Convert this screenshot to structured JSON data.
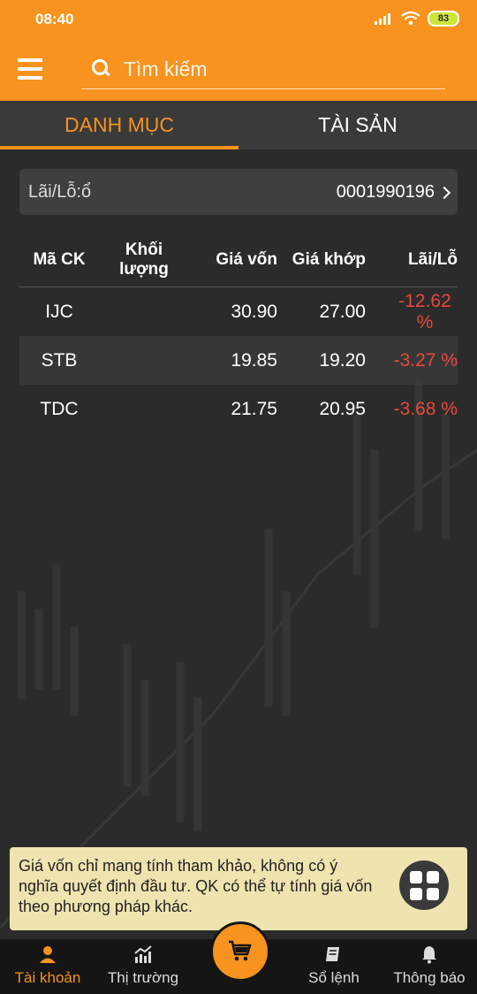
{
  "status": {
    "time": "08:40",
    "battery": "83"
  },
  "search": {
    "placeholder": "Tìm kiếm"
  },
  "tabs": [
    {
      "label": "DANH MỤC"
    },
    {
      "label": "TÀI SẢN"
    }
  ],
  "account": {
    "label": "Lãi/Lỗ:ổ",
    "number": "0001990196"
  },
  "table": {
    "headers": [
      "Mã CK",
      "Khối lượng",
      "Giá vốn",
      "Giá khớp",
      "Lãi/Lỗ"
    ],
    "rows": [
      {
        "code": "IJC",
        "volume": "",
        "cost": "30.90",
        "match": "27.00",
        "pl": "-12.62 %"
      },
      {
        "code": "STB",
        "volume": "",
        "cost": "19.85",
        "match": "19.20",
        "pl": "-3.27 %"
      },
      {
        "code": "TDC",
        "volume": "",
        "cost": "21.75",
        "match": "20.95",
        "pl": "-3.68 %"
      }
    ]
  },
  "note": {
    "text": "Giá vốn chỉ mang tính tham khảo, không có ý nghĩa quyết định đầu tư. QK có thể tự tính giá vốn theo phương pháp khác."
  },
  "nav": [
    {
      "label": "Tài khoản",
      "icon": "person-icon"
    },
    {
      "label": "Thị trường",
      "icon": "chart-icon"
    },
    {
      "label": "",
      "icon": "cart-icon"
    },
    {
      "label": "Sổ lệnh",
      "icon": "book-icon"
    },
    {
      "label": "Thông báo",
      "icon": "bell-icon"
    }
  ],
  "colors": {
    "accent": "#f7931e",
    "negative": "#e8483e",
    "background": "#2b2b2b"
  }
}
